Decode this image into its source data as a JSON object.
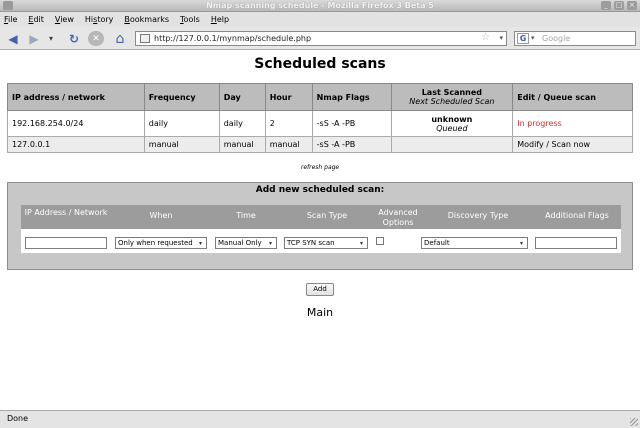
{
  "window": {
    "title": "Nmap scanning schedule - Mozilla Firefox 3 Beta 5",
    "buttons": [
      "_",
      "□",
      "×"
    ]
  },
  "menubar": {
    "items": [
      {
        "label": "File",
        "mnemonic": "F",
        "rest": "ile"
      },
      {
        "label": "Edit",
        "mnemonic": "E",
        "rest": "dit"
      },
      {
        "label": "View",
        "mnemonic": "V",
        "rest": "iew"
      },
      {
        "label": "History",
        "pre": "Hi",
        "mnemonic": "s",
        "rest": "tory"
      },
      {
        "label": "Bookmarks",
        "mnemonic": "B",
        "rest": "ookmarks"
      },
      {
        "label": "Tools",
        "mnemonic": "T",
        "rest": "ools"
      },
      {
        "label": "Help",
        "mnemonic": "H",
        "rest": "elp"
      }
    ]
  },
  "navbar": {
    "icons": {
      "back": "◀",
      "forward": "▶",
      "history": "▾",
      "reload": "↻",
      "stop": "✕",
      "home": "⌂"
    },
    "url": "http://127.0.0.1/mynmap/schedule.php",
    "star": "☆",
    "drop": "▾",
    "search_placeholder": "Google",
    "search_engine": "G"
  },
  "page": {
    "title": "Scheduled scans",
    "table": {
      "headers": {
        "ip": "IP address / network",
        "frequency": "Frequency",
        "day": "Day",
        "hour": "Hour",
        "flags": "Nmap Flags",
        "last": "Last Scanned",
        "next": "Next Scheduled Scan",
        "edit": "Edit / Queue scan"
      },
      "rows": [
        {
          "ip": "192.168.254.0/24",
          "frequency": "daily",
          "day": "daily",
          "hour": "2",
          "flags": "-sS -A -PB",
          "last": "unknown",
          "next": "Queued",
          "action": "In progress"
        },
        {
          "ip": "127.0.0.1",
          "frequency": "manual",
          "day": "manual",
          "hour": "manual",
          "flags": "-sS -A -PB",
          "last": "",
          "next": "",
          "action": "Modify / Scan now"
        }
      ]
    },
    "refresh": "refresh page",
    "add_form": {
      "title": "Add new scheduled scan:",
      "headers": {
        "ip": "IP Address / Network",
        "when": "When",
        "time": "Time",
        "scan_type": "Scan Type",
        "advanced": "Advanced Options",
        "discovery": "Discovery Type",
        "flags": "Additional Flags"
      },
      "ip_value": "",
      "when_value": "Only when requested",
      "time_value": "Manual Only",
      "scan_type_value": "TCP SYN scan",
      "advanced_checked": false,
      "discovery_value": "Default",
      "flags_value": "",
      "arrow": "▾"
    },
    "add_button": "Add",
    "main_link": "Main"
  },
  "status": {
    "text": "Done"
  },
  "colors": {
    "accent_red": "#c8342c",
    "header_gray": "#bcbcbc",
    "form_header": "#9c9c9c"
  }
}
